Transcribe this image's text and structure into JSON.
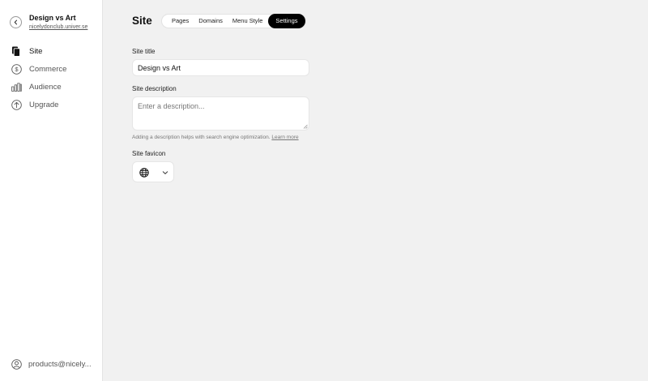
{
  "sidebar": {
    "site_name": "Design vs Art",
    "site_url": "nicelydonclub.univer.se",
    "items": [
      {
        "label": "Site",
        "icon": "pages-icon",
        "active": true
      },
      {
        "label": "Commerce",
        "icon": "dollar-icon",
        "active": false
      },
      {
        "label": "Audience",
        "icon": "bar-chart-icon",
        "active": false
      },
      {
        "label": "Upgrade",
        "icon": "arrow-up-circle-icon",
        "active": false
      }
    ],
    "account": "products@nicely..."
  },
  "header": {
    "title": "Site",
    "tabs": [
      {
        "label": "Pages",
        "active": false
      },
      {
        "label": "Domains",
        "active": false
      },
      {
        "label": "Menu Style",
        "active": false
      },
      {
        "label": "Settings",
        "active": true
      }
    ]
  },
  "form": {
    "site_title_label": "Site title",
    "site_title_value": "Design vs Art",
    "site_description_label": "Site description",
    "site_description_placeholder": "Enter a description...",
    "help_text": "Adding a description helps with search engine optimization.",
    "learn_more": "Learn more",
    "favicon_label": "Site favicon",
    "favicon_icon": "globe-icon"
  }
}
